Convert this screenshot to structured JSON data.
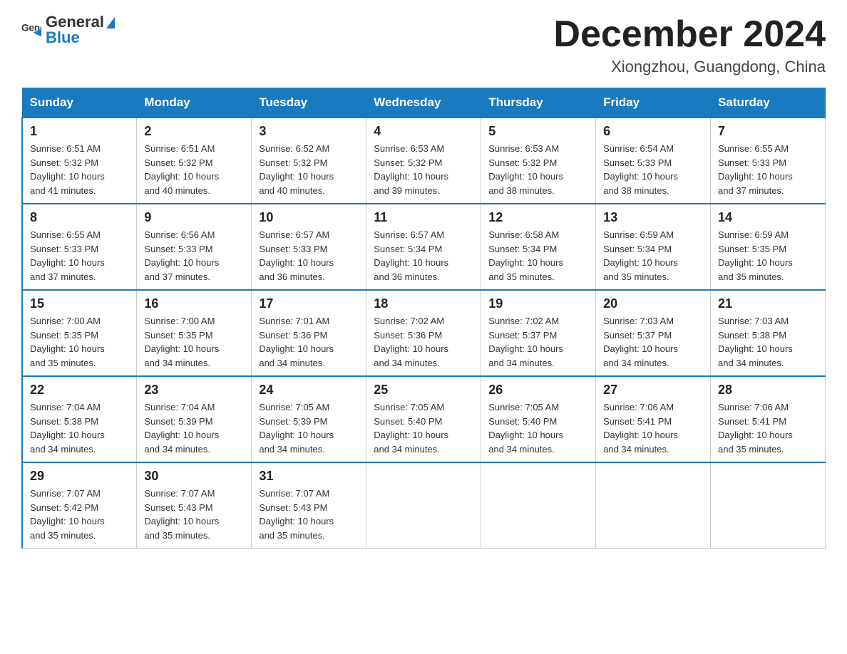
{
  "header": {
    "logo_general": "General",
    "logo_blue": "Blue",
    "month_title": "December 2024",
    "location": "Xiongzhou, Guangdong, China"
  },
  "weekdays": [
    "Sunday",
    "Monday",
    "Tuesday",
    "Wednesday",
    "Thursday",
    "Friday",
    "Saturday"
  ],
  "weeks": [
    [
      {
        "day": "1",
        "info": "Sunrise: 6:51 AM\nSunset: 5:32 PM\nDaylight: 10 hours\nand 41 minutes."
      },
      {
        "day": "2",
        "info": "Sunrise: 6:51 AM\nSunset: 5:32 PM\nDaylight: 10 hours\nand 40 minutes."
      },
      {
        "day": "3",
        "info": "Sunrise: 6:52 AM\nSunset: 5:32 PM\nDaylight: 10 hours\nand 40 minutes."
      },
      {
        "day": "4",
        "info": "Sunrise: 6:53 AM\nSunset: 5:32 PM\nDaylight: 10 hours\nand 39 minutes."
      },
      {
        "day": "5",
        "info": "Sunrise: 6:53 AM\nSunset: 5:32 PM\nDaylight: 10 hours\nand 38 minutes."
      },
      {
        "day": "6",
        "info": "Sunrise: 6:54 AM\nSunset: 5:33 PM\nDaylight: 10 hours\nand 38 minutes."
      },
      {
        "day": "7",
        "info": "Sunrise: 6:55 AM\nSunset: 5:33 PM\nDaylight: 10 hours\nand 37 minutes."
      }
    ],
    [
      {
        "day": "8",
        "info": "Sunrise: 6:55 AM\nSunset: 5:33 PM\nDaylight: 10 hours\nand 37 minutes."
      },
      {
        "day": "9",
        "info": "Sunrise: 6:56 AM\nSunset: 5:33 PM\nDaylight: 10 hours\nand 37 minutes."
      },
      {
        "day": "10",
        "info": "Sunrise: 6:57 AM\nSunset: 5:33 PM\nDaylight: 10 hours\nand 36 minutes."
      },
      {
        "day": "11",
        "info": "Sunrise: 6:57 AM\nSunset: 5:34 PM\nDaylight: 10 hours\nand 36 minutes."
      },
      {
        "day": "12",
        "info": "Sunrise: 6:58 AM\nSunset: 5:34 PM\nDaylight: 10 hours\nand 35 minutes."
      },
      {
        "day": "13",
        "info": "Sunrise: 6:59 AM\nSunset: 5:34 PM\nDaylight: 10 hours\nand 35 minutes."
      },
      {
        "day": "14",
        "info": "Sunrise: 6:59 AM\nSunset: 5:35 PM\nDaylight: 10 hours\nand 35 minutes."
      }
    ],
    [
      {
        "day": "15",
        "info": "Sunrise: 7:00 AM\nSunset: 5:35 PM\nDaylight: 10 hours\nand 35 minutes."
      },
      {
        "day": "16",
        "info": "Sunrise: 7:00 AM\nSunset: 5:35 PM\nDaylight: 10 hours\nand 34 minutes."
      },
      {
        "day": "17",
        "info": "Sunrise: 7:01 AM\nSunset: 5:36 PM\nDaylight: 10 hours\nand 34 minutes."
      },
      {
        "day": "18",
        "info": "Sunrise: 7:02 AM\nSunset: 5:36 PM\nDaylight: 10 hours\nand 34 minutes."
      },
      {
        "day": "19",
        "info": "Sunrise: 7:02 AM\nSunset: 5:37 PM\nDaylight: 10 hours\nand 34 minutes."
      },
      {
        "day": "20",
        "info": "Sunrise: 7:03 AM\nSunset: 5:37 PM\nDaylight: 10 hours\nand 34 minutes."
      },
      {
        "day": "21",
        "info": "Sunrise: 7:03 AM\nSunset: 5:38 PM\nDaylight: 10 hours\nand 34 minutes."
      }
    ],
    [
      {
        "day": "22",
        "info": "Sunrise: 7:04 AM\nSunset: 5:38 PM\nDaylight: 10 hours\nand 34 minutes."
      },
      {
        "day": "23",
        "info": "Sunrise: 7:04 AM\nSunset: 5:39 PM\nDaylight: 10 hours\nand 34 minutes."
      },
      {
        "day": "24",
        "info": "Sunrise: 7:05 AM\nSunset: 5:39 PM\nDaylight: 10 hours\nand 34 minutes."
      },
      {
        "day": "25",
        "info": "Sunrise: 7:05 AM\nSunset: 5:40 PM\nDaylight: 10 hours\nand 34 minutes."
      },
      {
        "day": "26",
        "info": "Sunrise: 7:05 AM\nSunset: 5:40 PM\nDaylight: 10 hours\nand 34 minutes."
      },
      {
        "day": "27",
        "info": "Sunrise: 7:06 AM\nSunset: 5:41 PM\nDaylight: 10 hours\nand 34 minutes."
      },
      {
        "day": "28",
        "info": "Sunrise: 7:06 AM\nSunset: 5:41 PM\nDaylight: 10 hours\nand 35 minutes."
      }
    ],
    [
      {
        "day": "29",
        "info": "Sunrise: 7:07 AM\nSunset: 5:42 PM\nDaylight: 10 hours\nand 35 minutes."
      },
      {
        "day": "30",
        "info": "Sunrise: 7:07 AM\nSunset: 5:43 PM\nDaylight: 10 hours\nand 35 minutes."
      },
      {
        "day": "31",
        "info": "Sunrise: 7:07 AM\nSunset: 5:43 PM\nDaylight: 10 hours\nand 35 minutes."
      },
      null,
      null,
      null,
      null
    ]
  ]
}
